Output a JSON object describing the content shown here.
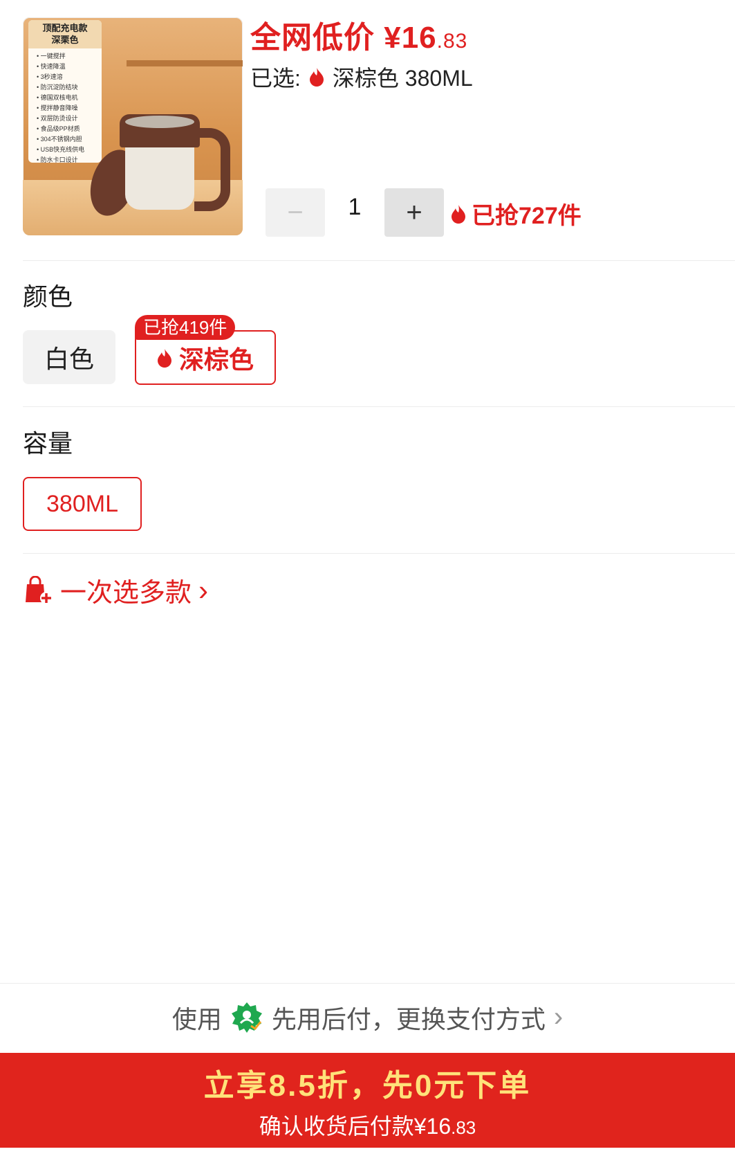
{
  "product": {
    "image_spec_title": "顶配充电款\n深栗色",
    "image_spec_title_line1": "顶配充电款",
    "image_spec_title_line2": "深栗色",
    "image_spec_items": [
      "一键搅拌",
      "快速降温",
      "3秒速溶",
      "防沉淀防结块",
      "德国双核电机",
      "搅拌静音降噪",
      "双层防烫设计",
      "食品级PP材质",
      "304不锈钢内胆",
      "USB快充线供电",
      "防水卡口设计"
    ]
  },
  "price": {
    "label": "全网低价 ¥16",
    "cents": ".83"
  },
  "selected": {
    "prefix": "已选:",
    "value": "深棕色 380ML"
  },
  "quantity": {
    "minus": "−",
    "value": "1",
    "plus": "+",
    "sold": "已抢727件"
  },
  "color_section": {
    "title": "颜色",
    "options": [
      {
        "label": "白色"
      },
      {
        "label": "深棕色",
        "badge": "已抢419件"
      }
    ]
  },
  "capacity_section": {
    "title": "容量",
    "options": [
      {
        "label": "380ML"
      }
    ]
  },
  "multi_select": {
    "label": "一次选多款",
    "chevron": "›"
  },
  "payment": {
    "prefix": "使用",
    "text": "先用后付，更换支付方式",
    "chevron": "›"
  },
  "cta": {
    "main": "立享8.5折，先0元下单",
    "sub": "确认收货后付款¥16",
    "sub_cents": ".83"
  },
  "colors": {
    "accent": "#e02020",
    "cta_bg": "#e0241d",
    "cta_text": "#ffe27a",
    "pay_icon": "#1fa84f"
  }
}
